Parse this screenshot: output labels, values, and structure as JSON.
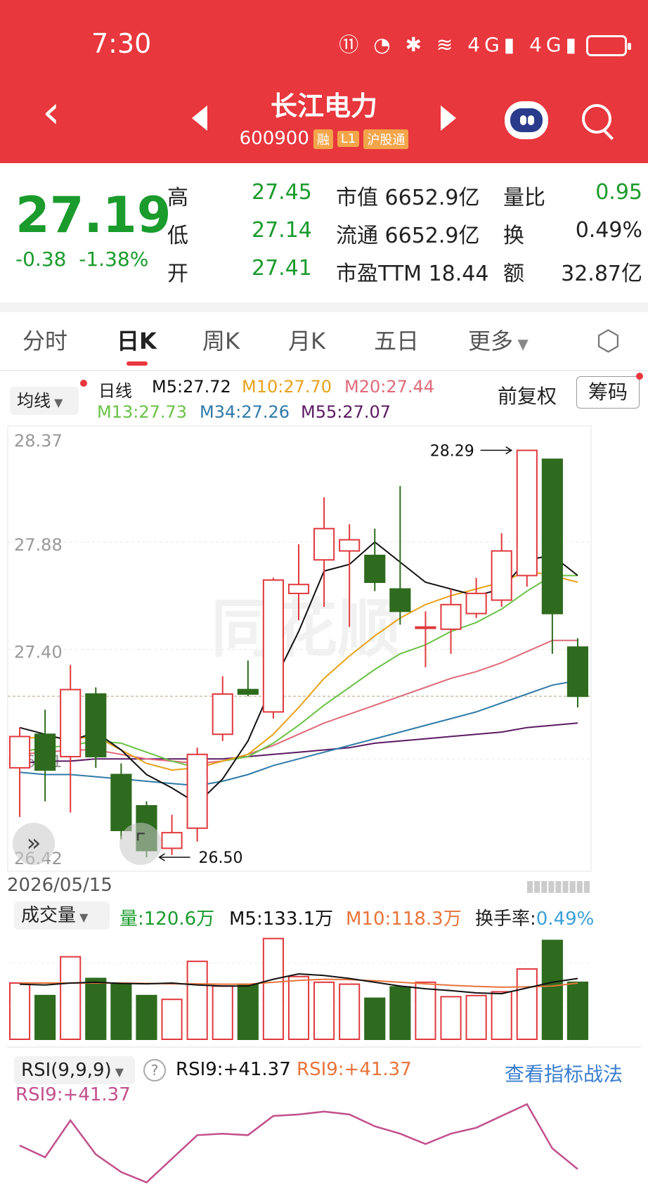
{
  "status_bar": {
    "time": "7:30",
    "icons_text": "⑪ ◔ ✱ ≋ 4G▮ 4G▮"
  },
  "header": {
    "back_icon": "‹",
    "title": "长江电力",
    "code": "600900",
    "tags": [
      "融",
      "L1",
      "沪股通"
    ]
  },
  "quote": {
    "price": "27.19",
    "change": "-0.38",
    "change_pct": "-1.38%",
    "rows": [
      {
        "l1": "高",
        "v1": "27.45",
        "l2": "市值",
        "v2": "6652.9亿",
        "l3": "量比",
        "v3": "0.95"
      },
      {
        "l1": "低",
        "v1": "27.14",
        "l2": "流通",
        "v2": "6652.9亿",
        "l3": "换",
        "v3": "0.49%"
      },
      {
        "l1": "开",
        "v1": "27.41",
        "l2": "市盈TTM",
        "v2": "18.44",
        "l3": "额",
        "v3": "32.87亿"
      }
    ]
  },
  "tabs": [
    "分时",
    "日K",
    "周K",
    "月K",
    "五日",
    "更多"
  ],
  "active_tab": "日K",
  "ma_panel": {
    "button": "均线",
    "type": "日线",
    "m5": "M5:27.72",
    "m10": "M10:27.70",
    "m20": "M20:27.44",
    "m13": "M13:27.73",
    "m34": "M34:27.26",
    "m55": "M55:27.07",
    "adjust": "前复权",
    "chip": "筹码"
  },
  "colors": {
    "up": "#e0393e",
    "down": "#2e6b1e",
    "m5": "#111111",
    "m10": "#e8a21b",
    "m20": "#e06a7a",
    "m13": "#6ac246",
    "m34": "#2f7aa8",
    "m55": "#5b1a63",
    "rsi": "#c24f8c"
  },
  "date_label": "2026/05/15",
  "volume_panel": {
    "button": "成交量",
    "vol": "量:120.6万",
    "m5": "M5:133.1万",
    "m10": "M10:118.3万",
    "turnover_label": "换手率:",
    "turnover": "0.49%"
  },
  "rsi_panel": {
    "button": "RSI(9,9,9)",
    "help": "?",
    "rsi1": "RSI9:+41.37",
    "rsi2": "RSI9:+41.37",
    "rsi3": "RSI9:+41.37",
    "link": "查看指标战法"
  },
  "chart_data": {
    "type": "candlestick",
    "y_ticks": [
      "28.37",
      "27.88",
      "27.40",
      "26.91",
      "26.42"
    ],
    "ylim": [
      26.42,
      28.37
    ],
    "high_annotation": "28.29",
    "low_annotation": "26.50",
    "candles": [
      {
        "o": 26.87,
        "c": 27.01,
        "h": 27.05,
        "l": 26.65
      },
      {
        "o": 27.02,
        "c": 26.86,
        "h": 27.13,
        "l": 26.72
      },
      {
        "o": 26.92,
        "c": 27.22,
        "h": 27.33,
        "l": 26.67
      },
      {
        "o": 27.2,
        "c": 26.92,
        "h": 27.23,
        "l": 26.87
      },
      {
        "o": 26.84,
        "c": 26.59,
        "h": 26.89,
        "l": 26.55
      },
      {
        "o": 26.7,
        "c": 26.5,
        "h": 26.72,
        "l": 26.47
      },
      {
        "o": 26.51,
        "c": 26.58,
        "h": 26.66,
        "l": 26.48
      },
      {
        "o": 26.6,
        "c": 26.93,
        "h": 26.96,
        "l": 26.54
      },
      {
        "o": 27.02,
        "c": 27.2,
        "h": 27.28,
        "l": 26.99
      },
      {
        "o": 27.22,
        "c": 27.2,
        "h": 27.35,
        "l": 27.19
      },
      {
        "o": 27.12,
        "c": 27.71,
        "h": 27.72,
        "l": 27.09
      },
      {
        "o": 27.65,
        "c": 27.69,
        "h": 27.87,
        "l": 27.53
      },
      {
        "o": 27.8,
        "c": 27.94,
        "h": 28.08,
        "l": 27.59
      },
      {
        "o": 27.84,
        "c": 27.89,
        "h": 27.96,
        "l": 27.5
      },
      {
        "o": 27.82,
        "c": 27.7,
        "h": 27.94,
        "l": 27.66
      },
      {
        "o": 27.67,
        "c": 27.57,
        "h": 28.13,
        "l": 27.51
      },
      {
        "o": 27.5,
        "c": 27.5,
        "h": 27.57,
        "l": 27.32
      },
      {
        "o": 27.49,
        "c": 27.6,
        "h": 27.67,
        "l": 27.38
      },
      {
        "o": 27.56,
        "c": 27.65,
        "h": 27.72,
        "l": 27.54
      },
      {
        "o": 27.62,
        "c": 27.84,
        "h": 27.92,
        "l": 27.59
      },
      {
        "o": 27.73,
        "c": 28.29,
        "h": 28.29,
        "l": 27.68
      },
      {
        "o": 28.25,
        "c": 27.56,
        "h": 28.25,
        "l": 27.38
      },
      {
        "o": 27.41,
        "c": 27.19,
        "h": 27.45,
        "l": 27.14
      }
    ],
    "ma5": [
      27.05,
      27.02,
      26.99,
      27.03,
      26.95,
      26.84,
      26.78,
      26.71,
      26.82,
      26.99,
      27.25,
      27.48,
      27.75,
      27.78,
      27.88,
      27.79,
      27.7,
      27.67,
      27.64,
      27.67,
      27.8,
      27.82,
      27.73
    ],
    "ma10": [
      27.0,
      27.01,
      27.0,
      27.01,
      26.95,
      26.89,
      26.86,
      26.87,
      26.9,
      26.93,
      27.02,
      27.14,
      27.27,
      27.37,
      27.46,
      27.54,
      27.6,
      27.64,
      27.67,
      27.7,
      27.75,
      27.73,
      27.7
    ],
    "ma13": [
      26.94,
      26.96,
      26.97,
      26.99,
      26.98,
      26.94,
      26.9,
      26.87,
      26.9,
      26.92,
      26.98,
      27.06,
      27.15,
      27.23,
      27.31,
      27.38,
      27.42,
      27.48,
      27.52,
      27.58,
      27.66,
      27.73,
      27.73
    ],
    "ma20": [
      26.93,
      26.94,
      26.95,
      26.95,
      26.93,
      26.91,
      26.9,
      26.89,
      26.9,
      26.93,
      26.97,
      27.02,
      27.07,
      27.11,
      27.15,
      27.19,
      27.23,
      27.27,
      27.3,
      27.34,
      27.39,
      27.44,
      27.44
    ],
    "ma34": [
      26.85,
      26.84,
      26.84,
      26.83,
      26.82,
      26.81,
      26.8,
      26.79,
      26.81,
      26.84,
      26.88,
      26.91,
      26.94,
      26.97,
      27.0,
      27.03,
      27.06,
      27.09,
      27.12,
      27.16,
      27.2,
      27.24,
      27.26
    ],
    "ma55": [
      26.89,
      26.9,
      26.9,
      26.91,
      26.91,
      26.91,
      26.91,
      26.91,
      26.91,
      26.92,
      26.93,
      26.94,
      26.95,
      26.96,
      26.98,
      26.99,
      27.0,
      27.01,
      27.02,
      27.03,
      27.05,
      27.06,
      27.07
    ],
    "volume": [
      148,
      115,
      217,
      160,
      145,
      115,
      105,
      205,
      140,
      145,
      265,
      165,
      150,
      145,
      108,
      138,
      150,
      112,
      115,
      125,
      185,
      260,
      150
    ],
    "vol_m5": [
      145,
      143,
      148,
      150,
      147,
      146,
      148,
      143,
      140,
      140,
      158,
      172,
      168,
      160,
      150,
      140,
      133,
      128,
      122,
      120,
      135,
      150,
      160
    ],
    "vol_m10": [
      148,
      148,
      148,
      148,
      148,
      147,
      146,
      146,
      145,
      145,
      150,
      155,
      158,
      157,
      154,
      150,
      146,
      142,
      139,
      137,
      138,
      140,
      148
    ],
    "vol_ylim": [
      0,
      270
    ],
    "rsi": [
      30,
      22,
      47,
      24,
      12,
      5,
      21,
      37,
      38,
      37,
      50,
      51,
      53,
      51,
      43,
      38,
      31,
      38,
      42,
      50,
      58,
      28,
      14
    ],
    "rsi_ylim": [
      0,
      60
    ]
  }
}
